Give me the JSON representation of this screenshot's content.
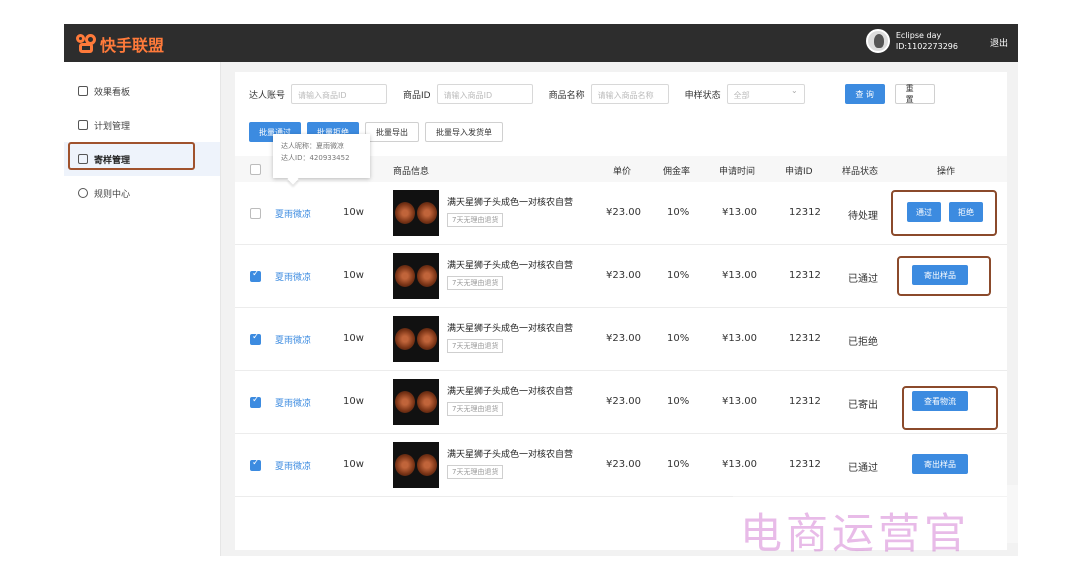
{
  "header": {
    "logo_text": "快手联盟",
    "user_name": "Eclipse day",
    "user_id": "ID:1102273296",
    "logout": "退出"
  },
  "sidebar": {
    "items": [
      {
        "label": "效果看板",
        "icon": "dashboard-icon"
      },
      {
        "label": "计划管理",
        "icon": "plan-icon"
      },
      {
        "label": "寄样管理",
        "icon": "sample-icon",
        "active": true
      },
      {
        "label": "规则中心",
        "icon": "rules-icon"
      }
    ]
  },
  "filters": {
    "account_label": "达人账号",
    "account_placeholder": "请输入商品ID",
    "product_id_label": "商品ID",
    "product_id_placeholder": "请输入商品ID",
    "product_name_label": "商品名称",
    "product_name_placeholder": "请输入商品名称",
    "status_label": "申样状态",
    "status_value": "全部",
    "query": "查 询",
    "reset": "重 置"
  },
  "actions": {
    "batch_pass": "批量通过",
    "batch_reject": "批量拒绝",
    "batch_export": "批量导出",
    "batch_import": "批量导入发货单"
  },
  "table": {
    "headers": [
      "商品信息",
      "单价",
      "佣金率",
      "申请时间",
      "申请ID",
      "样品状态",
      "操作"
    ],
    "tooltip": {
      "nick": "达人昵称：夏雨微凉",
      "id": "达人ID：420933452"
    },
    "rows": [
      {
        "checked": false,
        "nick": "夏雨微凉",
        "fans": "10w",
        "product": "满天星狮子头成色一对核农自营",
        "tag": "7天无理由退货",
        "price": "¥23.00",
        "rate": "10%",
        "time": "¥13.00",
        "apply_id": "12312",
        "status": "待处理",
        "ops": [
          "通过",
          "拒绝"
        ]
      },
      {
        "checked": true,
        "nick": "夏雨微凉",
        "fans": "10w",
        "product": "满天星狮子头成色一对核农自营",
        "tag": "7天无理由退货",
        "price": "¥23.00",
        "rate": "10%",
        "time": "¥13.00",
        "apply_id": "12312",
        "status": "已通过",
        "ops": [
          "寄出样品"
        ]
      },
      {
        "checked": true,
        "nick": "夏雨微凉",
        "fans": "10w",
        "product": "满天星狮子头成色一对核农自营",
        "tag": "7天无理由退货",
        "price": "¥23.00",
        "rate": "10%",
        "time": "¥13.00",
        "apply_id": "12312",
        "status": "已拒绝",
        "ops": []
      },
      {
        "checked": true,
        "nick": "夏雨微凉",
        "fans": "10w",
        "product": "满天星狮子头成色一对核农自营",
        "tag": "7天无理由退货",
        "price": "¥23.00",
        "rate": "10%",
        "time": "¥13.00",
        "apply_id": "12312",
        "status": "已寄出",
        "ops": [
          "查看物流"
        ]
      },
      {
        "checked": true,
        "nick": "夏雨微凉",
        "fans": "10w",
        "product": "满天星狮子头成色一对核农自营",
        "tag": "7天无理由退货",
        "price": "¥23.00",
        "rate": "10%",
        "time": "¥13.00",
        "apply_id": "12312",
        "status": "已通过",
        "ops": [
          "寄出样品"
        ]
      }
    ]
  },
  "watermark": "电商运营官",
  "colors": {
    "primary": "#3c8be0",
    "brand": "#ff7a3a",
    "highlight": "#8b4a2b"
  }
}
